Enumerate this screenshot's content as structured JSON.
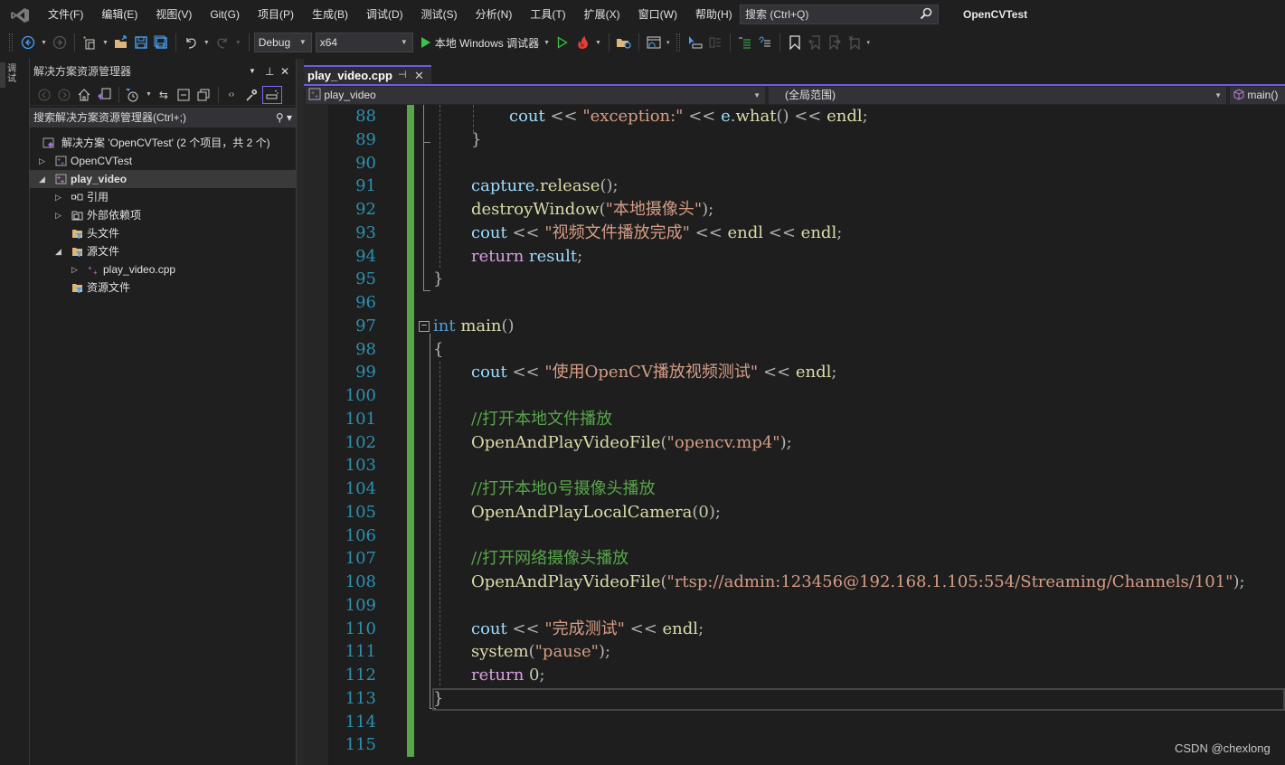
{
  "menubar": {
    "items": [
      "文件(F)",
      "编辑(E)",
      "视图(V)",
      "Git(G)",
      "项目(P)",
      "生成(B)",
      "调试(D)",
      "测试(S)",
      "分析(N)",
      "工具(T)",
      "扩展(X)",
      "窗口(W)",
      "帮助(H)"
    ],
    "search_placeholder": "搜索 (Ctrl+Q)",
    "app_title": "OpenCVTest"
  },
  "toolbar": {
    "configuration": "Debug",
    "platform": "x64",
    "run_target": "本地 Windows 调试器"
  },
  "left_strip": {
    "tab_label": "调试"
  },
  "solution_explorer": {
    "title": "解决方案资源管理器",
    "search_placeholder": "搜索解决方案资源管理器(Ctrl+;)",
    "tree": [
      {
        "label": "解决方案 'OpenCVTest' (2 个项目，共 2 个)",
        "depth": 0,
        "expander": "",
        "icon": "solution-icon"
      },
      {
        "label": "OpenCVTest",
        "depth": 1,
        "expander": "collapsed",
        "icon": "cpp-project-icon"
      },
      {
        "label": "play_video",
        "depth": 1,
        "expander": "expanded",
        "icon": "cpp-project-icon",
        "selected": true
      },
      {
        "label": "引用",
        "depth": 2,
        "expander": "collapsed",
        "icon": "references-icon"
      },
      {
        "label": "外部依赖项",
        "depth": 2,
        "expander": "collapsed",
        "icon": "external-deps-icon"
      },
      {
        "label": "头文件",
        "depth": 2,
        "expander": "",
        "icon": "filter-folder-icon"
      },
      {
        "label": "源文件",
        "depth": 2,
        "expander": "expanded",
        "icon": "filter-folder-icon"
      },
      {
        "label": "play_video.cpp",
        "depth": 3,
        "expander": "collapsed",
        "icon": "cpp-file-icon"
      },
      {
        "label": "资源文件",
        "depth": 2,
        "expander": "",
        "icon": "filter-folder-icon"
      }
    ]
  },
  "editor": {
    "tab": {
      "label": "play_video.cpp"
    },
    "nav": {
      "project": "play_video",
      "scope": "(全局范围)",
      "member": "main()"
    },
    "lines": [
      {
        "n": "88",
        "indent": 2,
        "tokens": [
          [
            "v",
            "cout"
          ],
          [
            "op",
            " << "
          ],
          [
            "s",
            "\"exception:\""
          ],
          [
            "op",
            " << "
          ],
          [
            "v",
            "e"
          ],
          [
            "op",
            "."
          ],
          [
            "f",
            "what"
          ],
          [
            "op",
            "() << "
          ],
          [
            "f",
            "endl"
          ],
          [
            "op",
            ";"
          ]
        ]
      },
      {
        "n": "89",
        "indent": 1,
        "tokens": [
          [
            "op",
            "}"
          ]
        ]
      },
      {
        "n": "90",
        "indent": 0,
        "tokens": []
      },
      {
        "n": "91",
        "indent": 1,
        "tokens": [
          [
            "v",
            "capture"
          ],
          [
            "op",
            "."
          ],
          [
            "f",
            "release"
          ],
          [
            "op",
            "();"
          ]
        ]
      },
      {
        "n": "92",
        "indent": 1,
        "tokens": [
          [
            "f",
            "destroyWindow"
          ],
          [
            "op",
            "("
          ],
          [
            "s",
            "\"本地摄像头\""
          ],
          [
            "op",
            ");"
          ]
        ]
      },
      {
        "n": "93",
        "indent": 1,
        "tokens": [
          [
            "v",
            "cout"
          ],
          [
            "op",
            " << "
          ],
          [
            "s",
            "\"视频文件播放完成\""
          ],
          [
            "op",
            " << "
          ],
          [
            "f",
            "endl"
          ],
          [
            "op",
            " << "
          ],
          [
            "f",
            "endl"
          ],
          [
            "op",
            ";"
          ]
        ]
      },
      {
        "n": "94",
        "indent": 1,
        "tokens": [
          [
            "ctrl",
            "return"
          ],
          [
            "op",
            " "
          ],
          [
            "v",
            "result"
          ],
          [
            "op",
            ";"
          ]
        ]
      },
      {
        "n": "95",
        "indent": 0,
        "tokens": [
          [
            "op",
            "}"
          ]
        ]
      },
      {
        "n": "96",
        "indent": 0,
        "tokens": []
      },
      {
        "n": "97",
        "indent": 0,
        "tokens": [
          [
            "k",
            "int"
          ],
          [
            "op",
            " "
          ],
          [
            "f",
            "main"
          ],
          [
            "op",
            "()"
          ]
        ]
      },
      {
        "n": "98",
        "indent": 0,
        "tokens": [
          [
            "op",
            "{"
          ]
        ]
      },
      {
        "n": "99",
        "indent": 1,
        "tokens": [
          [
            "v",
            "cout"
          ],
          [
            "op",
            " << "
          ],
          [
            "s",
            "\"使用OpenCV播放视频测试\""
          ],
          [
            "op",
            " << "
          ],
          [
            "f",
            "endl"
          ],
          [
            "op",
            ";"
          ]
        ]
      },
      {
        "n": "100",
        "indent": 0,
        "tokens": []
      },
      {
        "n": "101",
        "indent": 1,
        "tokens": [
          [
            "c",
            "//打开本地文件播放"
          ]
        ]
      },
      {
        "n": "102",
        "indent": 1,
        "tokens": [
          [
            "f",
            "OpenAndPlayVideoFile"
          ],
          [
            "op",
            "("
          ],
          [
            "s",
            "\"opencv.mp4\""
          ],
          [
            "op",
            ");"
          ]
        ]
      },
      {
        "n": "103",
        "indent": 0,
        "tokens": []
      },
      {
        "n": "104",
        "indent": 1,
        "tokens": [
          [
            "c",
            "//打开本地0号摄像头播放"
          ]
        ]
      },
      {
        "n": "105",
        "indent": 1,
        "tokens": [
          [
            "f",
            "OpenAndPlayLocalCamera"
          ],
          [
            "op",
            "("
          ],
          [
            "n",
            "0"
          ],
          [
            "op",
            ");"
          ]
        ]
      },
      {
        "n": "106",
        "indent": 0,
        "tokens": []
      },
      {
        "n": "107",
        "indent": 1,
        "tokens": [
          [
            "c",
            "//打开网络摄像头播放"
          ]
        ]
      },
      {
        "n": "108",
        "indent": 1,
        "tokens": [
          [
            "f",
            "OpenAndPlayVideoFile"
          ],
          [
            "op",
            "("
          ],
          [
            "s",
            "\"rtsp://admin:123456@192.168.1.105:554/Streaming/Channels/101\""
          ],
          [
            "op",
            ");"
          ]
        ]
      },
      {
        "n": "109",
        "indent": 0,
        "tokens": []
      },
      {
        "n": "110",
        "indent": 1,
        "tokens": [
          [
            "v",
            "cout"
          ],
          [
            "op",
            " << "
          ],
          [
            "s",
            "\"完成测试\""
          ],
          [
            "op",
            " << "
          ],
          [
            "f",
            "endl"
          ],
          [
            "op",
            ";"
          ]
        ]
      },
      {
        "n": "111",
        "indent": 1,
        "tokens": [
          [
            "f",
            "system"
          ],
          [
            "op",
            "("
          ],
          [
            "s",
            "\"pause\""
          ],
          [
            "op",
            ");"
          ]
        ]
      },
      {
        "n": "112",
        "indent": 1,
        "tokens": [
          [
            "ctrl",
            "return"
          ],
          [
            "op",
            " "
          ],
          [
            "n",
            "0"
          ],
          [
            "op",
            ";"
          ]
        ]
      },
      {
        "n": "113",
        "indent": 0,
        "tokens": [
          [
            "op",
            "}"
          ]
        ]
      },
      {
        "n": "114",
        "indent": 0,
        "tokens": []
      },
      {
        "n": "115",
        "indent": 0,
        "tokens": []
      }
    ]
  },
  "watermark": "CSDN @chexlong"
}
